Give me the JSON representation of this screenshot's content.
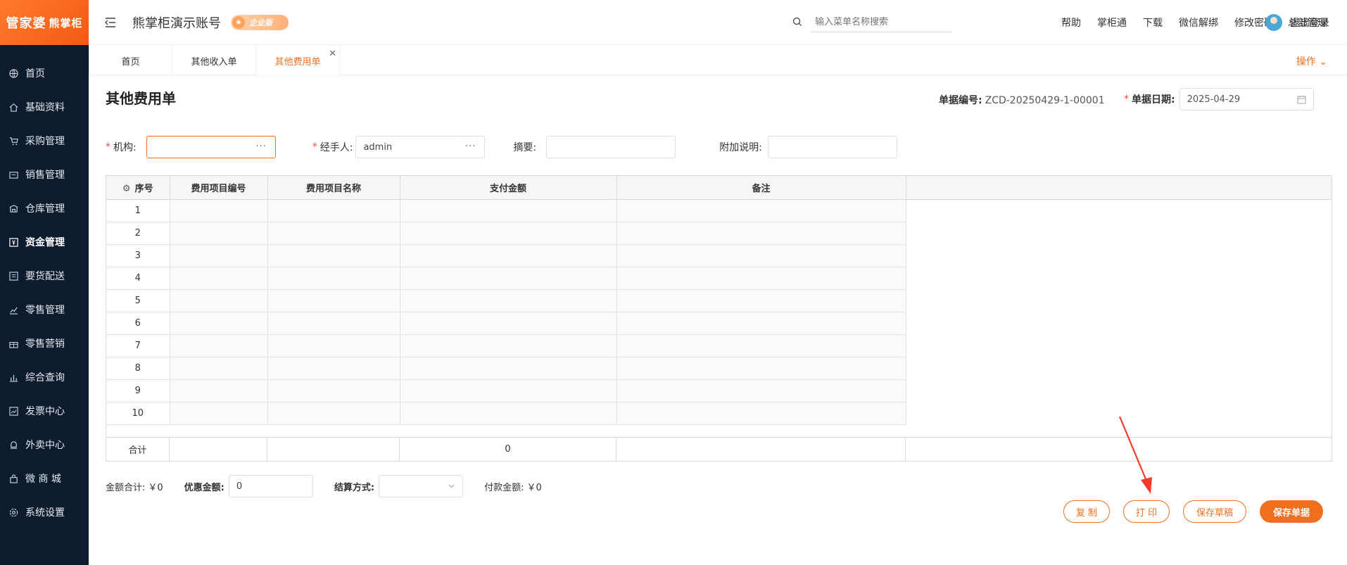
{
  "sidebar": {
    "logo_main": "管家婆",
    "logo_sub": "熊掌柜",
    "items": [
      {
        "label": "首页",
        "icon": "globe-icon"
      },
      {
        "label": "基础资料",
        "icon": "home-icon"
      },
      {
        "label": "采购管理",
        "icon": "cart-icon"
      },
      {
        "label": "销售管理",
        "icon": "sales-icon"
      },
      {
        "label": "仓库管理",
        "icon": "warehouse-icon"
      },
      {
        "label": "资金管理",
        "icon": "money-icon"
      },
      {
        "label": "要货配送",
        "icon": "list-icon"
      },
      {
        "label": "零售管理",
        "icon": "chart-icon"
      },
      {
        "label": "零售营销",
        "icon": "gift-icon"
      },
      {
        "label": "综合查询",
        "icon": "bar-chart-icon"
      },
      {
        "label": "发票中心",
        "icon": "trend-icon"
      },
      {
        "label": "外卖中心",
        "icon": "bell-icon"
      },
      {
        "label": "微 商 城",
        "icon": "shop-icon"
      },
      {
        "label": "系统设置",
        "icon": "gear-icon"
      }
    ],
    "active_index": 5
  },
  "header": {
    "account_title": "熊掌柜演示账号",
    "edition_badge": "企业版",
    "search_placeholder": "输入菜单名称搜索",
    "links": [
      "帮助",
      "掌柜通",
      "下载",
      "微信解绑",
      "修改密码",
      "退出登录"
    ],
    "user_name": "总部管理"
  },
  "tabs": {
    "items": [
      "首页",
      "其他收入单",
      "其他费用单"
    ],
    "active_index": 2,
    "ops_label": "操作"
  },
  "form": {
    "page_title": "其他费用单",
    "doc_no_label": "单据编号:",
    "doc_no_value": "ZCD-20250429-1-00001",
    "doc_date_label": "单据日期:",
    "doc_date_value": "2025-04-29",
    "org_label": "机构:",
    "org_value": "",
    "handler_label": "经手人:",
    "handler_value": "admin",
    "summary_label": "摘要:",
    "summary_value": "",
    "note_label": "附加说明:",
    "note_value": ""
  },
  "table": {
    "columns": [
      "序号",
      "费用项目编号",
      "费用项目名称",
      "支付金额",
      "备注"
    ],
    "rows": [
      "1",
      "2",
      "3",
      "4",
      "5",
      "6",
      "7",
      "8",
      "9",
      "10"
    ],
    "total_label": "合计",
    "total_amount": "0"
  },
  "footer": {
    "amount_total_label": "金额合计:",
    "amount_total_value": "￥0",
    "discount_label": "优惠金额:",
    "discount_value": "0",
    "settle_label": "结算方式:",
    "pay_label": "付款金额:",
    "pay_value": "￥0"
  },
  "buttons": {
    "copy": "复 制",
    "print": "打 印",
    "save_draft": "保存草稿",
    "save": "保存单据"
  },
  "colors": {
    "accent": "#f07020",
    "sidebar_bg": "#0d1b2e"
  }
}
